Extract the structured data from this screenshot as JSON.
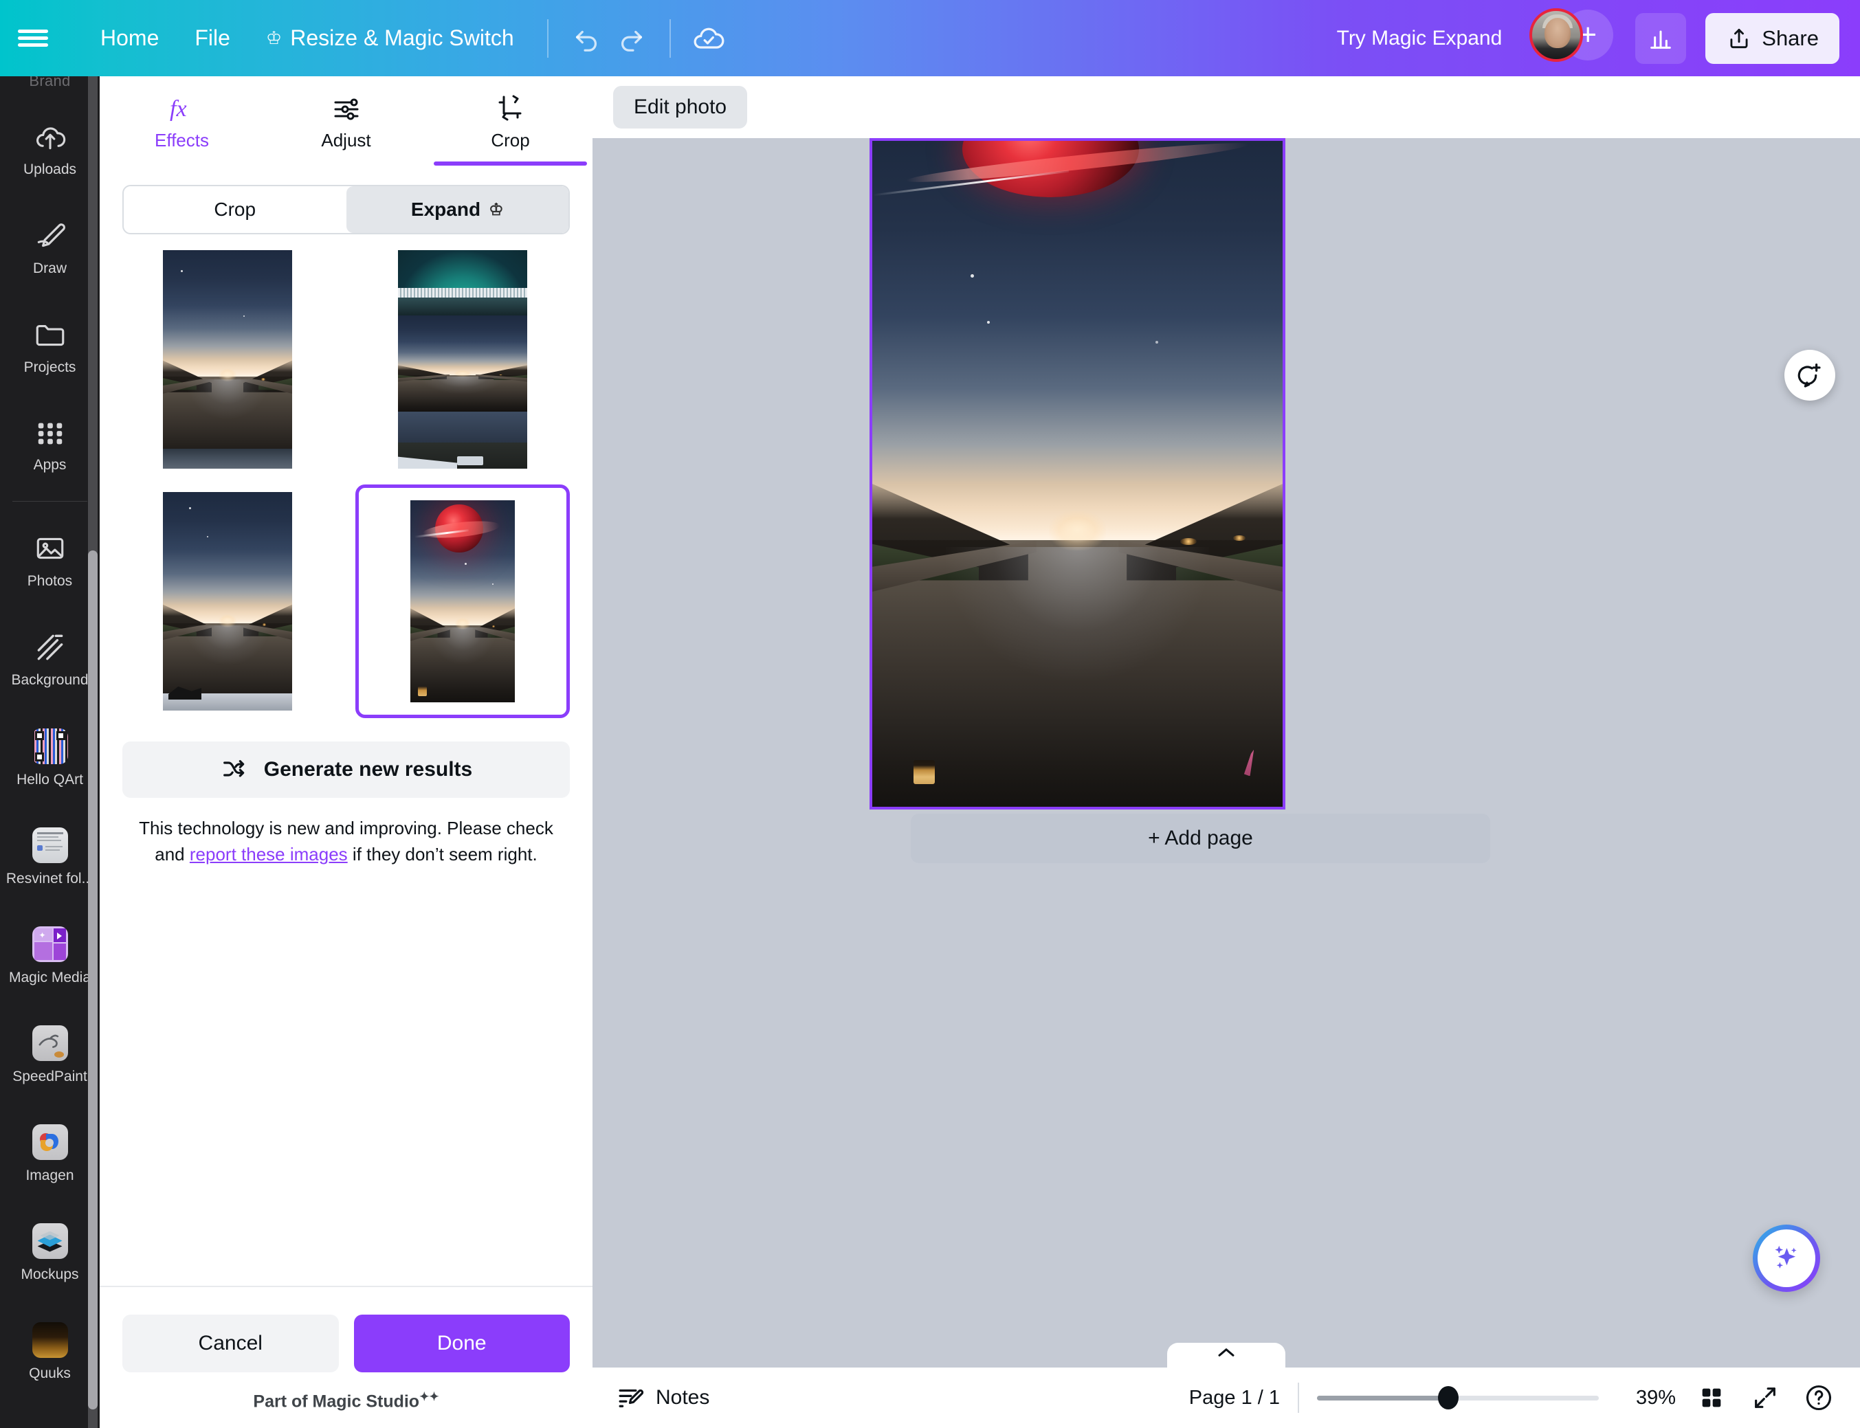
{
  "topbar": {
    "menu_icon": "hamburger-icon",
    "items": [
      {
        "label": "Home",
        "icon": null
      },
      {
        "label": "File",
        "icon": null
      },
      {
        "label": "Resize & Magic Switch",
        "icon": "crown-icon"
      }
    ],
    "undo_icon": "undo-icon",
    "redo_icon": "redo-icon",
    "cloud_saved_icon": "cloud-check-icon",
    "try_magic_expand": "Try Magic Expand",
    "avatar": "user-avatar",
    "add_collaborator_icon": "plus-icon",
    "stats_icon": "bar-chart-icon",
    "share_label": "Share",
    "share_icon": "share-upload-icon",
    "accent_start": "#00c4cc",
    "accent_end": "#8b3dfb"
  },
  "rail": {
    "cut_label": "Brand",
    "items": [
      {
        "label": "Uploads",
        "icon": "cloud-upload-icon",
        "type": "glyph"
      },
      {
        "label": "Draw",
        "icon": "pen-icon",
        "type": "glyph"
      },
      {
        "label": "Projects",
        "icon": "folder-icon",
        "type": "glyph"
      },
      {
        "label": "Apps",
        "icon": "grid-apps-icon",
        "type": "glyph"
      },
      {
        "label": "Photos",
        "icon": "photo-icon",
        "type": "glyph"
      },
      {
        "label": "Background",
        "icon": "stripes-icon",
        "type": "glyph"
      },
      {
        "label": "Hello QArt",
        "icon": "qr-code-app-icon",
        "type": "tile"
      },
      {
        "label": "Resvinet fol...",
        "icon": "document-app-icon",
        "type": "tile"
      },
      {
        "label": "Magic Media",
        "icon": "magic-media-app-icon",
        "type": "tile"
      },
      {
        "label": "SpeedPaint",
        "icon": "speedpaint-app-icon",
        "type": "tile"
      },
      {
        "label": "Imagen",
        "icon": "imagen-app-icon",
        "type": "tile"
      },
      {
        "label": "Mockups",
        "icon": "mockups-app-icon",
        "type": "tile"
      },
      {
        "label": "Quuks",
        "icon": "quuks-app-icon",
        "type": "tile"
      }
    ],
    "background": "#1e1e20"
  },
  "panel": {
    "tabs": [
      {
        "label": "Effects",
        "icon": "fx-icon",
        "active": false
      },
      {
        "label": "Adjust",
        "icon": "sliders-icon",
        "active": false
      },
      {
        "label": "Crop",
        "icon": "crop-rotate-icon",
        "active": true
      }
    ],
    "segmented": [
      {
        "label": "Crop",
        "active": false,
        "icon": null
      },
      {
        "label": "Expand",
        "active": true,
        "icon": "crown-icon"
      }
    ],
    "results": [
      {
        "name": "result-1",
        "variant": "wide-sky",
        "selected": false
      },
      {
        "name": "result-2",
        "variant": "aurora-stack",
        "selected": false
      },
      {
        "name": "result-3",
        "variant": "snow-foreground",
        "selected": false
      },
      {
        "name": "result-4",
        "variant": "red-planet",
        "selected": true
      }
    ],
    "generate_label": "Generate new results",
    "generate_icon": "shuffle-icon",
    "disclaimer_part1": "This technology is new and improving. Please check and",
    "disclaimer_link": "report these images",
    "disclaimer_part2": "if they don’t seem right.",
    "cancel_label": "Cancel",
    "done_label": "Done",
    "magic_studio_label": "Part of Magic Studio",
    "accent": "#8b3dfb"
  },
  "workspace": {
    "edit_photo_label": "Edit photo",
    "comment_icon": "add-comment-icon",
    "add_page_label": "+ Add page",
    "collapse_icon": "chevron-up-icon",
    "magic_fab_icon": "magic-sparkles-icon",
    "selection_color": "#8b3dfb"
  },
  "bottombar": {
    "notes_label": "Notes",
    "notes_icon": "notes-pencil-icon",
    "page_label": "Page 1 / 1",
    "zoom_level": "39%",
    "grid_view_icon": "grid-view-icon",
    "fullscreen_icon": "expand-fullscreen-icon",
    "help_icon": "help-question-icon"
  }
}
